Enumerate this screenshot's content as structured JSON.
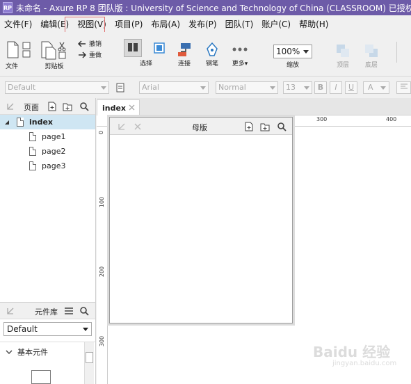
{
  "window": {
    "app_icon": "RP",
    "title": "未命名 - Axure RP 8 团队版 : University of Science and Technology of China (CLASSROOM) 已授权"
  },
  "menubar": {
    "items": [
      "文件(F)",
      "编辑(E)",
      "视图(V)",
      "项目(P)",
      "布局(A)",
      "发布(P)",
      "团队(T)",
      "账户(C)",
      "帮助(H)"
    ]
  },
  "toolbar": {
    "file_label": "文件",
    "clipboard_label": "剪贴板",
    "undo_label": "撤销",
    "redo_label": "重做",
    "select_label": "选择",
    "connect_label": "连接",
    "pen_label": "钢笔",
    "more_label": "更多▾",
    "zoom_value": "100%",
    "zoom_label": "缩放",
    "top_label": "顶层",
    "bottom_label": "底层"
  },
  "formatbar": {
    "style_value": "Default",
    "font_value": "Arial",
    "weight_value": "Normal",
    "size_value": "13",
    "bold": "B",
    "italic": "I",
    "underline": "U",
    "color": "A"
  },
  "pages_panel": {
    "title": "页面",
    "root": "index",
    "children": [
      "page1",
      "page2",
      "page3"
    ]
  },
  "widgets_panel": {
    "title": "元件库",
    "library": "Default",
    "group": "基本元件"
  },
  "canvas": {
    "tab_label": "index",
    "ruler_top": [
      "300",
      "400"
    ],
    "ruler_left": [
      "0",
      "100",
      "200",
      "300"
    ]
  },
  "masters_panel": {
    "title": "母版"
  },
  "watermark": {
    "text": "Baidu 经验",
    "sub": "jingyan.baidu.com"
  }
}
